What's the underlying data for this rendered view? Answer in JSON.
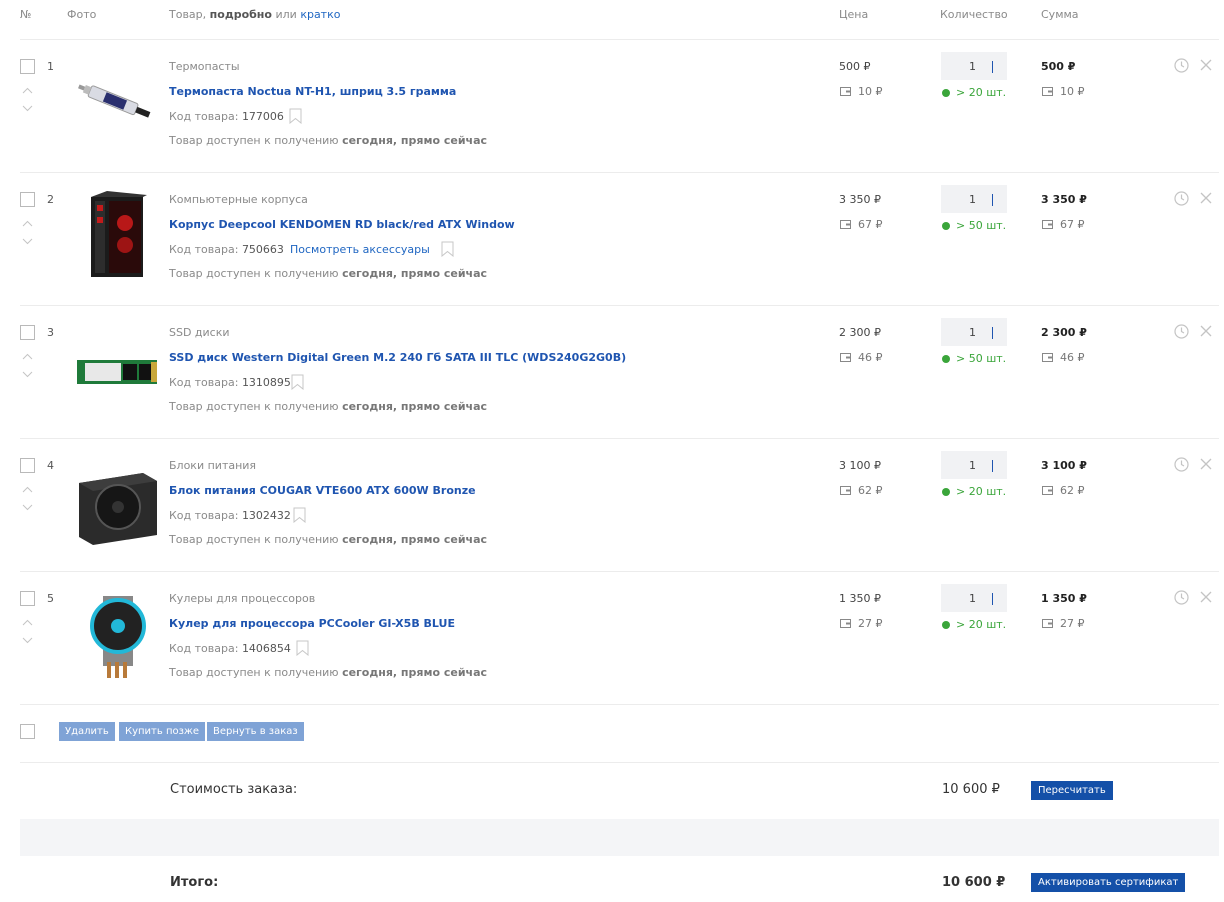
{
  "header": {
    "num": "№",
    "photo": "Фото",
    "product_prefix": "Товар,",
    "product_detailed": "подробно",
    "product_or": "или",
    "product_brief": "кратко",
    "price": "Цена",
    "quantity": "Количество",
    "sum": "Сумма"
  },
  "labels": {
    "code_prefix": "Код товара:",
    "avail_prefix": "Товар доступен к получению",
    "avail_when": "сегодня, прямо сейчас",
    "accessories": "Посмотреть аксессуары"
  },
  "items": [
    {
      "num": "1",
      "category": "Термопасты",
      "title": "Термопаста Noctua NT-H1, шприц 3.5 грамма",
      "code": "177006",
      "price": "500 ₽",
      "bonus": "10 ₽",
      "qty": "1",
      "stock": "> 20 шт.",
      "sum": "500 ₽",
      "sum_bonus": "10 ₽",
      "image": "thermal-paste-syringe"
    },
    {
      "num": "2",
      "category": "Компьютерные корпуса",
      "title": "Корпус Deepcool KENDOMEN RD black/red ATX Window",
      "code": "750663",
      "price": "3 350 ₽",
      "bonus": "67 ₽",
      "qty": "1",
      "stock": "> 50 шт.",
      "sum": "3 350 ₽",
      "sum_bonus": "67 ₽",
      "image": "pc-case"
    },
    {
      "num": "3",
      "category": "SSD диски",
      "title": "SSD диск Western Digital Green M.2 240 Гб SATA III TLC (WDS240G2G0B)",
      "code": "1310895",
      "price": "2 300 ₽",
      "bonus": "46 ₽",
      "qty": "1",
      "stock": "> 50 шт.",
      "sum": "2 300 ₽",
      "sum_bonus": "46 ₽",
      "image": "m2-ssd"
    },
    {
      "num": "4",
      "category": "Блоки питания",
      "title": "Блок питания COUGAR VTE600 ATX 600W Bronze",
      "code": "1302432",
      "price": "3 100 ₽",
      "bonus": "62 ₽",
      "qty": "1",
      "stock": "> 20 шт.",
      "sum": "3 100 ₽",
      "sum_bonus": "62 ₽",
      "image": "power-supply"
    },
    {
      "num": "5",
      "category": "Кулеры для процессоров",
      "title": "Кулер для процессора PCCooler GI-X5B BLUE",
      "code": "1406854",
      "price": "1 350 ₽",
      "bonus": "27 ₽",
      "qty": "1",
      "stock": "> 20 шт.",
      "sum": "1 350 ₽",
      "sum_bonus": "27 ₽",
      "image": "cpu-cooler"
    }
  ],
  "actions": {
    "delete": "Удалить",
    "buy_later": "Купить позже",
    "return_to_order": "Вернуть в заказ"
  },
  "order_cost": {
    "label": "Стоимость заказа:",
    "value": "10 600 ₽",
    "button": "Пересчитать"
  },
  "total": {
    "label": "Итого:",
    "value": "10 600 ₽",
    "button": "Активировать сертификат"
  },
  "colors": {
    "link": "#1f55b0",
    "stock_green": "#3aa53a",
    "primary_button": "#1450a8",
    "secondary_button": "#7fa3d6"
  }
}
